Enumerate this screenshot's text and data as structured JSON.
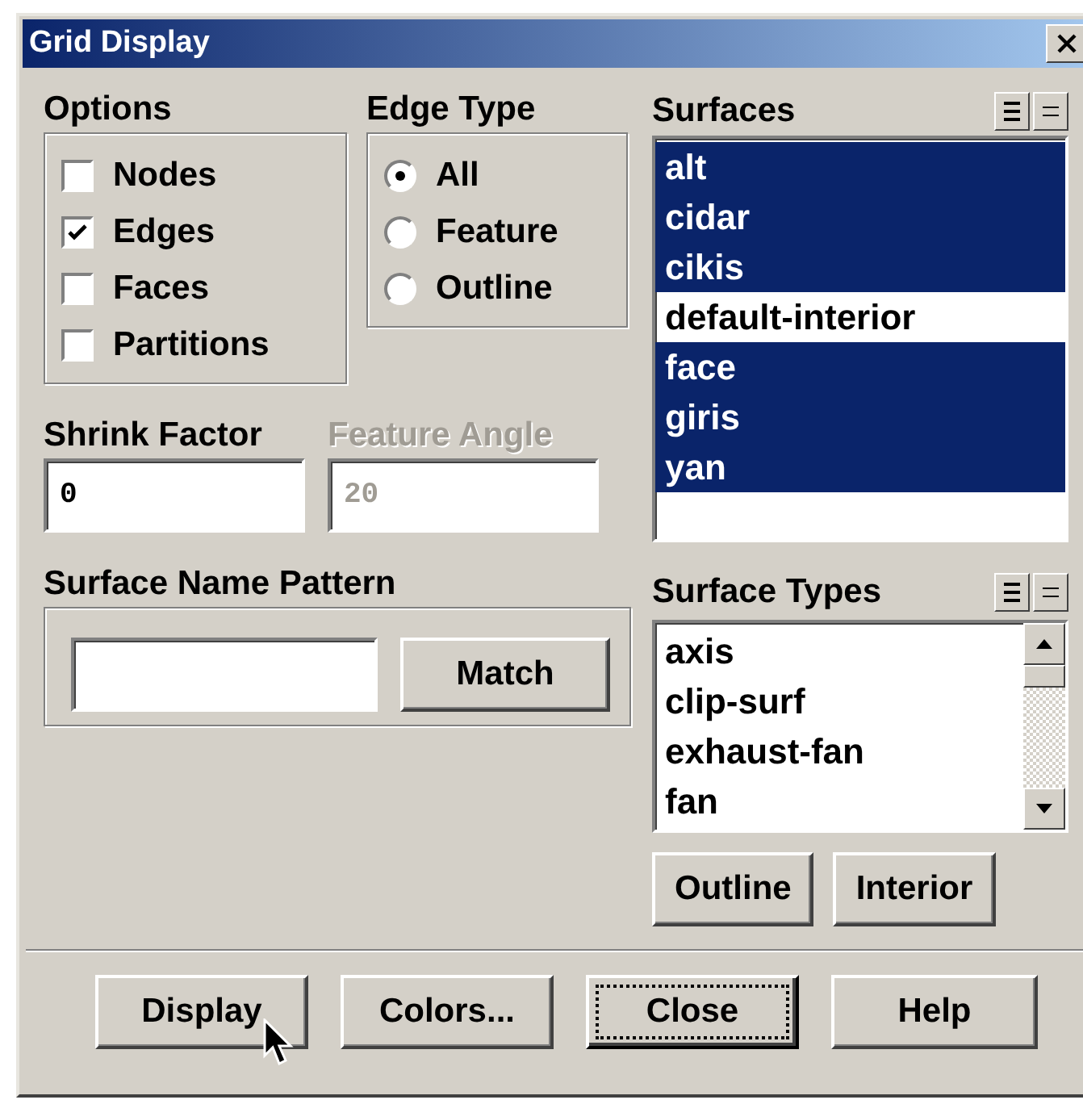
{
  "window": {
    "title": "Grid Display"
  },
  "options": {
    "title": "Options",
    "items": [
      {
        "label": "Nodes",
        "checked": false
      },
      {
        "label": "Edges",
        "checked": true
      },
      {
        "label": "Faces",
        "checked": false
      },
      {
        "label": "Partitions",
        "checked": false
      }
    ]
  },
  "edge_type": {
    "title": "Edge Type",
    "items": [
      {
        "label": "All",
        "selected": true
      },
      {
        "label": "Feature",
        "selected": false
      },
      {
        "label": "Outline",
        "selected": false
      }
    ]
  },
  "surfaces": {
    "title": "Surfaces",
    "items": [
      {
        "label": "alt",
        "selected": true
      },
      {
        "label": "cidar",
        "selected": true
      },
      {
        "label": "cikis",
        "selected": true
      },
      {
        "label": "default-interior",
        "selected": false
      },
      {
        "label": "face",
        "selected": true
      },
      {
        "label": "giris",
        "selected": true
      },
      {
        "label": "yan",
        "selected": true
      }
    ]
  },
  "shrink_factor": {
    "label": "Shrink Factor",
    "value": "0",
    "disabled": false
  },
  "feature_angle": {
    "label": "Feature Angle",
    "value": "20",
    "disabled": true
  },
  "surface_name_pattern": {
    "title": "Surface Name Pattern",
    "button": "Match"
  },
  "surface_types": {
    "title": "Surface Types",
    "items": [
      {
        "label": "axis",
        "selected": false
      },
      {
        "label": "clip-surf",
        "selected": false
      },
      {
        "label": "exhaust-fan",
        "selected": false
      },
      {
        "label": "fan",
        "selected": false
      }
    ],
    "buttons": [
      "Outline",
      "Interior"
    ]
  },
  "buttons": [
    {
      "label": "Display",
      "focused": false
    },
    {
      "label": "Colors...",
      "focused": false
    },
    {
      "label": "Close",
      "focused": true
    },
    {
      "label": "Help",
      "focused": false
    }
  ]
}
